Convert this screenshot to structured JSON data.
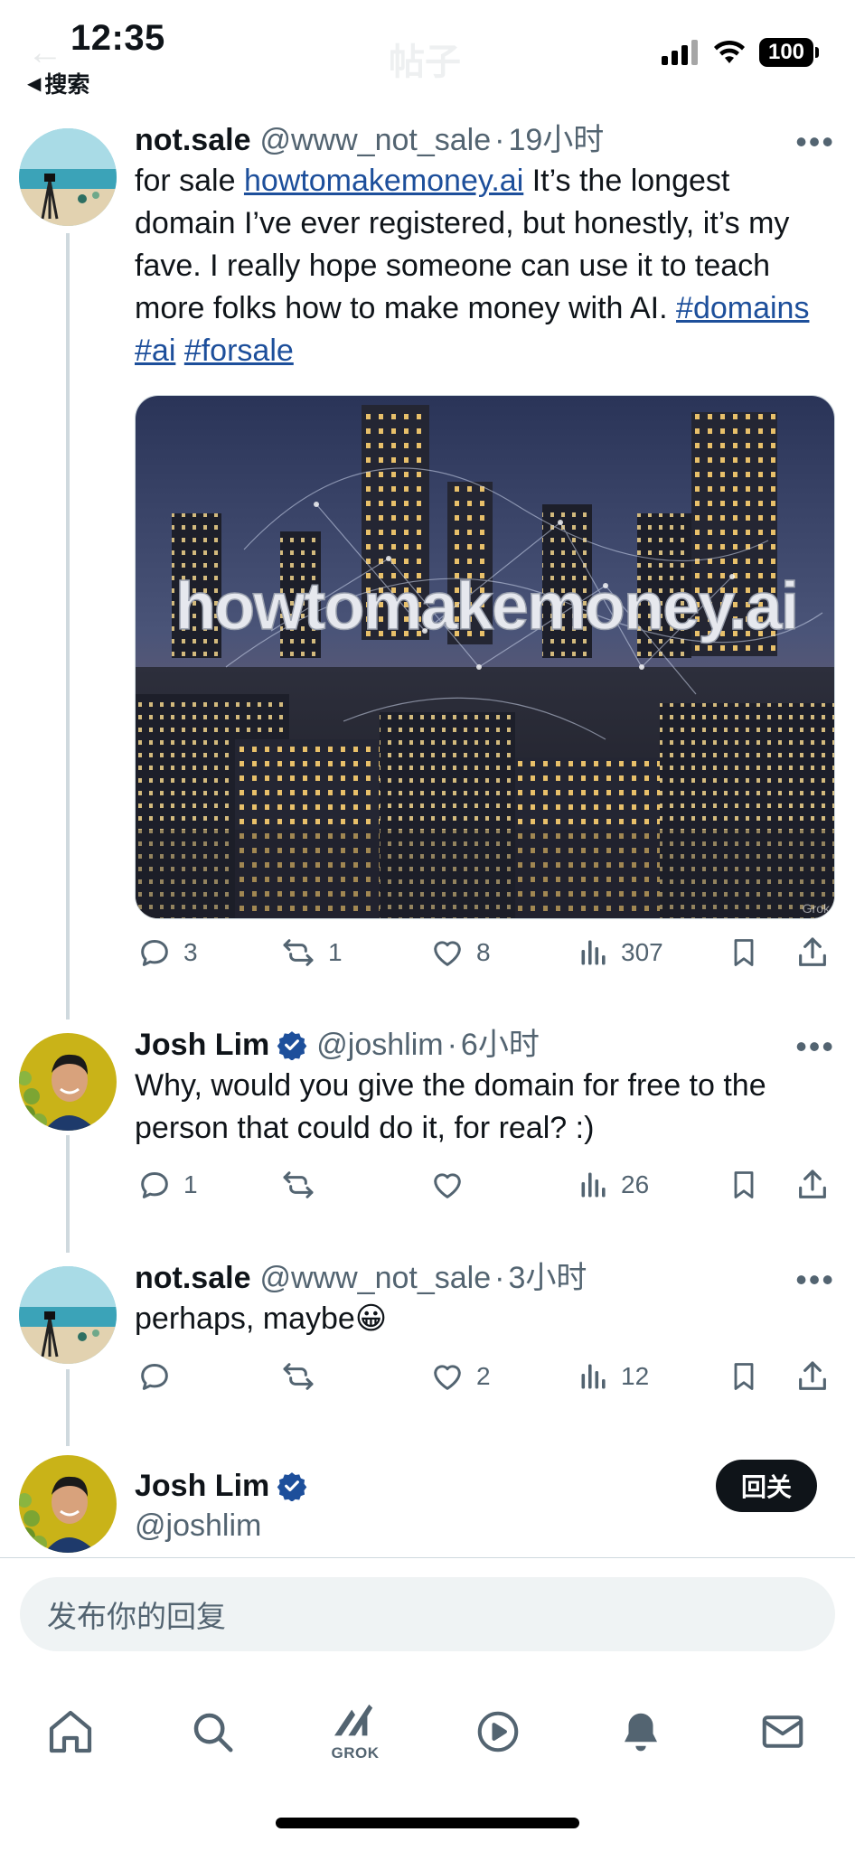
{
  "status_bar": {
    "time": "12:35",
    "back_label": "搜索",
    "battery": "100",
    "nav_title": "帖子"
  },
  "posts": [
    {
      "name": "not.sale",
      "handle": "@www_not_sale",
      "time": "19小时",
      "verified": false,
      "text_prefix": "for sale ",
      "link": "howtomakemoney.ai",
      "text_main": " It’s the longest domain I’ve ever registered, but honestly, it’s my fave. I really hope someone can use it to teach more folks how to make money with AI. ",
      "hashtags": [
        "#domains",
        "#ai",
        "#forsale"
      ],
      "media_text": "howtomakemoney.ai",
      "media_watermark": "Grok",
      "stats": {
        "replies": "3",
        "reposts": "1",
        "likes": "8",
        "views": "307"
      }
    },
    {
      "name": "Josh Lim",
      "handle": "@joshlim",
      "time": "6小时",
      "verified": true,
      "text": "Why, would you give the domain for free to the person that could do it, for real? :)",
      "stats": {
        "replies": "1",
        "reposts": "",
        "likes": "",
        "views": "26"
      }
    },
    {
      "name": "not.sale",
      "handle": "@www_not_sale",
      "time": "3小时",
      "verified": false,
      "text": "perhaps, maybe😀",
      "stats": {
        "replies": "",
        "reposts": "",
        "likes": "2",
        "views": "12"
      }
    }
  ],
  "reply_header": {
    "name": "Josh Lim",
    "handle": "@joshlim",
    "follow_label": "回关"
  },
  "reply_input": {
    "placeholder": "发布你的回复"
  },
  "tabbar": {
    "grok_label": "GROK",
    "icons": [
      "home-icon",
      "search-icon",
      "grok-icon",
      "video-icon",
      "notifications-icon",
      "messages-icon"
    ]
  },
  "colors": {
    "text": "#0f1419",
    "secondary": "#536471",
    "verified": "#1d9bf0",
    "link": "#1d4f9b"
  }
}
